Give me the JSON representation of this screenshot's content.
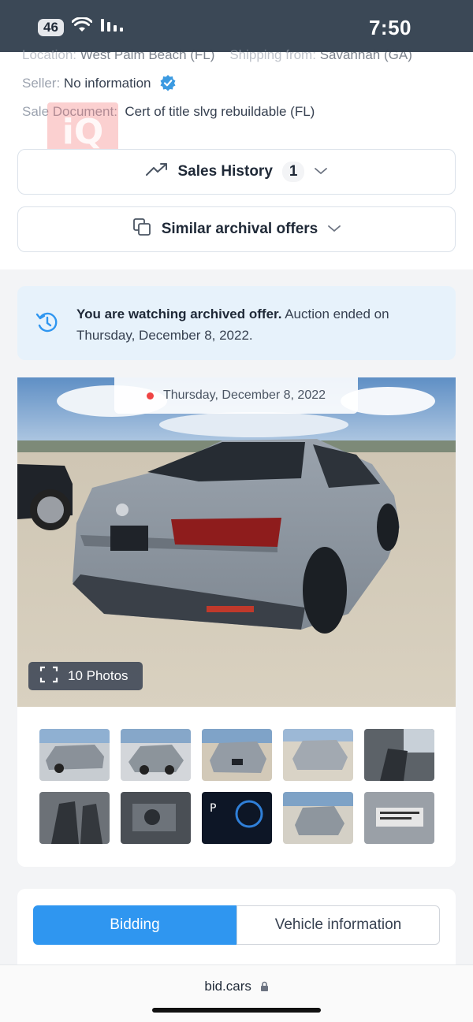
{
  "status_bar": {
    "network_badge": "46",
    "time": "7:50"
  },
  "details": {
    "location_label": "Location:",
    "location_value": "West Palm Beach (FL)",
    "shipping_label": "Shipping from:",
    "shipping_value": "Savannah (GA)",
    "seller_label": "Seller:",
    "seller_value": "No information",
    "sale_doc_label": "Sale Document:",
    "sale_doc_value": "Cert of title slvg rebuildable (FL)"
  },
  "watermark": {
    "text": "iQ"
  },
  "sales_history": {
    "label": "Sales History",
    "count": "1"
  },
  "similar_offers": {
    "label": "Similar archival offers"
  },
  "notice": {
    "bold": "You are watching archived offer.",
    "text": " Auction ended on Thursday, December 8, 2022."
  },
  "photo": {
    "date": "Thursday, December 8, 2022",
    "photos_count_label": "10 Photos"
  },
  "thumbnails": [
    {
      "name": "front-left damage"
    },
    {
      "name": "front damage"
    },
    {
      "name": "rear view"
    },
    {
      "name": "rear left"
    },
    {
      "name": "front interior"
    },
    {
      "name": "rear seats"
    },
    {
      "name": "engine bay"
    },
    {
      "name": "dashboard"
    },
    {
      "name": "front wide"
    },
    {
      "name": "vin label"
    }
  ],
  "tabs": {
    "bidding": "Bidding",
    "vehicle_info": "Vehicle information",
    "active": "bidding"
  },
  "browser": {
    "url": "bid.cars"
  },
  "colors": {
    "accent": "#2f96f0",
    "status_bar": "#3b4856",
    "notice_bg": "#e7f2fb",
    "verified": "#3b9ae1",
    "live_dot": "#ef4444"
  }
}
